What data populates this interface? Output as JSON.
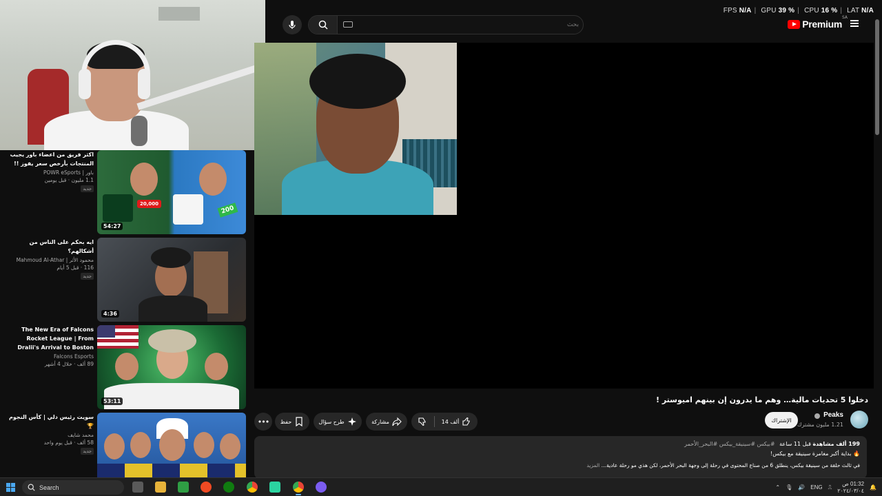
{
  "perf": {
    "fps_label": "FPS",
    "fps_value": "N/A",
    "gpu_label": "GPU",
    "gpu_value": "39 %",
    "cpu_label": "CPU",
    "cpu_value": "16 %",
    "lat_label": "LAT",
    "lat_value": "N/A"
  },
  "header": {
    "search_placeholder": "بحث",
    "logo_text": "Premium",
    "logo_region": "SA"
  },
  "video": {
    "title": "دخلوا 5 تحديات مالية… وهم ما يدرون إن بينهم اميوستر !",
    "channel": "Peaks",
    "subscribers": "1.21 مليون مشترك",
    "subscribe_label": "الإشتراك",
    "likes": "14 ألف",
    "share_label": "مشاركة",
    "ask_label": "طرح سؤال",
    "save_label": "حفظ"
  },
  "description": {
    "views": "199 ألف مشاهدة",
    "age": "قبل 11 ساعة",
    "tags": "#بيكس #سينيقة_بيكس #البحر_الأحمر",
    "line1": "بداية أكبر مغامرة سينيقة مع بيكس!",
    "line2": "في ثالث حلقة من سينيقة بيكس، ينطلق 6 من صناع المحتوى في رحلة إلى وجهة البحر الأحمر، لكن هذي مو رحلة عادية…",
    "more": "المزيد"
  },
  "recommendations": [
    {
      "title": "اكثر فريق من اعضاء باور يجيب المنتجات بأرخص سعر يفوز !!",
      "channel": "باور | POWR eSports",
      "stats": "1.1 مليون · قبل يومين",
      "badge": "جديد",
      "duration": "54:27",
      "overlay_price_1": "20,000",
      "overlay_price_2": "200"
    },
    {
      "title": "ايه بحكم على الناس من أشكالهم؟",
      "channel": "محمود الأثر | Mahmoud Al-Athar",
      "stats": "116 · قبل 5 أيام",
      "badge": "جديد",
      "duration": "4:36"
    },
    {
      "title": "The New Era of Falcons Rocket League | From Dralii's Arrival to Boston",
      "channel": "Falcons Esports",
      "stats": "89 ألف · خلال 4 أشهر",
      "badge": "",
      "duration": "53:11"
    },
    {
      "title": "سويت رئيس دلي | كأس النجوم 🏆",
      "channel": "محمد شايف",
      "stats": "58 ألف · قبل يوم واحد",
      "badge": "جديد",
      "duration": ""
    }
  ],
  "taskbar": {
    "search_label": "Search",
    "lang": "ENG",
    "time": "01:32 ص",
    "date": "٢٠٢٤/٠٣/٠٤"
  },
  "colors": {
    "background": "#0f0f0f",
    "surface": "#272727",
    "youtube_red": "#ff0000",
    "text_secondary": "#aaaaaa"
  }
}
